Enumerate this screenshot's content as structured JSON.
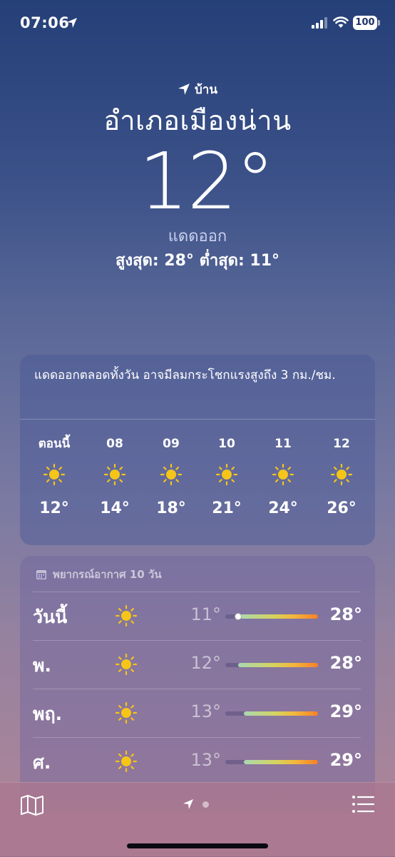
{
  "status_bar": {
    "time": "07:06",
    "battery": "100"
  },
  "location": {
    "home_label": "บ้าน",
    "city": "อำเภอเมืองน่าน",
    "temperature": "12°",
    "condition": "แดดออก",
    "hi_lo": "สูงสุด: 28°  ต่ำสุด: 11°"
  },
  "hourly": {
    "summary": "แดดออกตลอดทั้งวัน อาจมีลมกระโชกแรงสูงถึง 3 กม./ชม.",
    "items": [
      {
        "label": "ตอนนี้",
        "temp": "12°",
        "icon": "sun-icon"
      },
      {
        "label": "08",
        "temp": "14°",
        "icon": "sun-icon"
      },
      {
        "label": "09",
        "temp": "18°",
        "icon": "sun-icon"
      },
      {
        "label": "10",
        "temp": "21°",
        "icon": "sun-icon"
      },
      {
        "label": "11",
        "temp": "24°",
        "icon": "sun-icon"
      },
      {
        "label": "12",
        "temp": "26°",
        "icon": "sun-icon"
      }
    ]
  },
  "daily": {
    "header": "พยากรณ์อากาศ 10 วัน",
    "items": [
      {
        "day": "วันนี้",
        "low": "11°",
        "high": "28°",
        "icon": "sun-icon",
        "range_start": 0.14,
        "range_end": 1.0,
        "current_marker": 0.14
      },
      {
        "day": "พ.",
        "low": "12°",
        "high": "28°",
        "icon": "sun-icon",
        "range_start": 0.14,
        "range_end": 1.0
      },
      {
        "day": "พฤ.",
        "low": "13°",
        "high": "29°",
        "icon": "sun-icon",
        "range_start": 0.2,
        "range_end": 1.0
      },
      {
        "day": "ศ.",
        "low": "13°",
        "high": "29°",
        "icon": "sun-icon",
        "range_start": 0.2,
        "range_end": 1.0
      }
    ]
  },
  "colors": {
    "sun": "#f5c518",
    "gradient_top": "#253f78",
    "gradient_bottom": "#b08696"
  }
}
